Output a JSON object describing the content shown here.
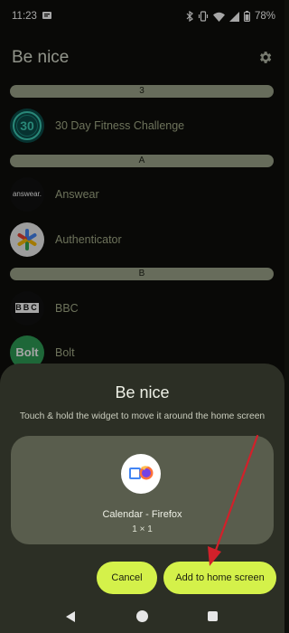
{
  "status_bar": {
    "time": "11:23",
    "battery": "78%"
  },
  "header": {
    "title": "Be nice"
  },
  "list": {
    "sections": [
      "3",
      "A",
      "B"
    ],
    "items": [
      {
        "label": "30 Day Fitness Challenge",
        "icon": "fitness-30-icon",
        "icon_text": "30"
      },
      {
        "label": "Answear",
        "icon": "answear-icon",
        "icon_text": "answear."
      },
      {
        "label": "Authenticator",
        "icon": "authenticator-icon"
      },
      {
        "label": "BBC",
        "icon": "bbc-icon",
        "icon_text": "BBC"
      },
      {
        "label": "Bolt",
        "icon": "bolt-icon",
        "icon_text": "Bolt"
      }
    ]
  },
  "sheet": {
    "title": "Be nice",
    "description": "Touch & hold the widget to move it around the home screen",
    "widget_name": "Calendar - Firefox",
    "widget_size": "1 × 1",
    "cancel_label": "Cancel",
    "add_label": "Add to home screen"
  },
  "colors": {
    "accent": "#d4f14a",
    "sheet": "#2c2f25",
    "preview": "#595d4d",
    "section_bar": "#9ea68d",
    "annotation_arrow": "#d2202a"
  }
}
